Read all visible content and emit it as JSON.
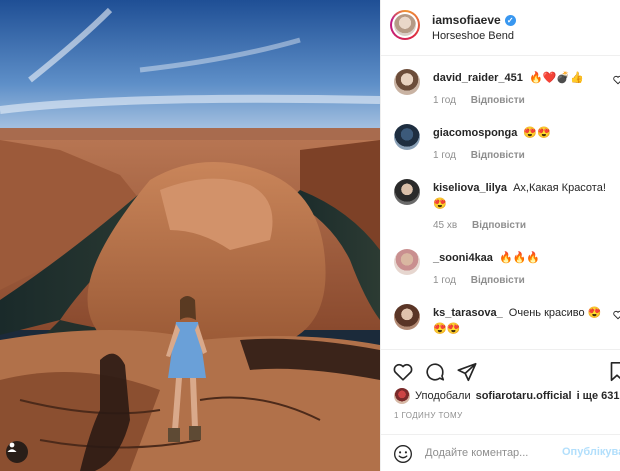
{
  "post": {
    "username": "iamsofiaeve",
    "location": "Horseshoe Bend",
    "verified": true
  },
  "comments": [
    {
      "username": "david_raider_451",
      "text": "🔥❤️💣👍",
      "time": "1 год",
      "reply": "Відповісти"
    },
    {
      "username": "giacomosponga",
      "text": "😍😍",
      "time": "1 год",
      "reply": "Відповісти"
    },
    {
      "username": "kiseliova_lilya",
      "text": "Ах,Какая Красота! 😍",
      "time": "45 хв",
      "reply": "Відповісти"
    },
    {
      "username": "_sooni4kaa",
      "text": "🔥🔥🔥",
      "time": "1 год",
      "reply": "Відповісти"
    },
    {
      "username": "ks_tarasova_",
      "text": "Очень красиво 😍 😍😍",
      "time": "",
      "reply": ""
    }
  ],
  "likes": {
    "prefix": "Уподобали",
    "user": "sofiarotaru.official",
    "suffix": "і ще 631"
  },
  "time_ago": "1 ГОДИНУ ТОМУ",
  "add_comment": {
    "placeholder": "Додайте коментар...",
    "publish_label": "Опублікувати"
  },
  "icons": {
    "heart": "heart-icon",
    "comment": "comment-icon",
    "share": "share-icon",
    "save": "bookmark-icon",
    "emoji": "emoji-icon",
    "tag": "user-tag-icon"
  },
  "colors": {
    "accent_link": "#b2dffc",
    "verified": "#3897f0",
    "meta": "#8e8e8e"
  }
}
